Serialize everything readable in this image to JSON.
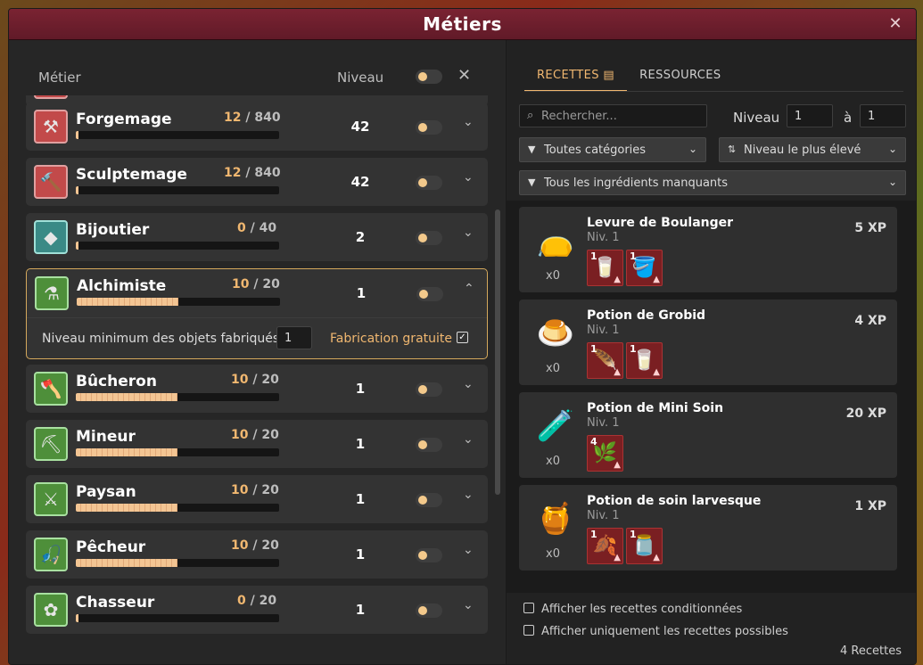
{
  "window": {
    "title": "Métiers"
  },
  "left": {
    "header": {
      "col_job": "Métier",
      "col_level": "Niveau"
    },
    "jobs": [
      {
        "name": "Forgemage",
        "xp_cur": "12",
        "xp_max": "840",
        "progress": 0.014,
        "level": "42",
        "icon": "hammer-icon"
      },
      {
        "name": "Sculptemage",
        "xp_cur": "12",
        "xp_max": "840",
        "progress": 0.014,
        "level": "42",
        "icon": "chisel-icon"
      },
      {
        "name": "Bijoutier",
        "xp_cur": "0",
        "xp_max": "40",
        "progress": 0.0,
        "level": "2",
        "icon": "gem-icon"
      },
      {
        "name": "Alchimiste",
        "xp_cur": "10",
        "xp_max": "20",
        "progress": 0.5,
        "level": "1",
        "icon": "potion-icon",
        "expanded": {
          "min_level_label": "Niveau minimum des objets fabriqués",
          "min_level_value": "1",
          "free_label": "Fabrication gratuite",
          "free_checked": true
        }
      },
      {
        "name": "Bûcheron",
        "xp_cur": "10",
        "xp_max": "20",
        "progress": 0.5,
        "level": "1",
        "icon": "axe-icon"
      },
      {
        "name": "Mineur",
        "xp_cur": "10",
        "xp_max": "20",
        "progress": 0.5,
        "level": "1",
        "icon": "pickaxe-icon"
      },
      {
        "name": "Paysan",
        "xp_cur": "10",
        "xp_max": "20",
        "progress": 0.5,
        "level": "1",
        "icon": "scythe-icon"
      },
      {
        "name": "Pêcheur",
        "xp_cur": "10",
        "xp_max": "20",
        "progress": 0.5,
        "level": "1",
        "icon": "fishing-rod-icon"
      },
      {
        "name": "Chasseur",
        "xp_cur": "0",
        "xp_max": "20",
        "progress": 0.0,
        "level": "1",
        "icon": "hunter-icon"
      }
    ]
  },
  "right": {
    "tabs": [
      {
        "label": "RECETTES",
        "active": true
      },
      {
        "label": "RESSOURCES",
        "active": false
      }
    ],
    "search_placeholder": "Rechercher...",
    "level_label": "Niveau",
    "level_from": "1",
    "level_to_label": "à",
    "level_to": "1",
    "filter_category": "Toutes catégories",
    "sort": "Niveau le plus élevé",
    "filter_ingredients": "Tous les ingrédients manquants",
    "recipes": [
      {
        "name": "Levure de Boulanger",
        "level": "Niv. 1",
        "xp": "5 XP",
        "qty": "x0",
        "icon": "yeast-bag-icon",
        "ingredients": [
          {
            "n": "1",
            "icon": "flour-icon"
          },
          {
            "n": "1",
            "icon": "bucket-icon"
          }
        ]
      },
      {
        "name": "Potion de Grobid",
        "level": "Niv. 1",
        "xp": "4 XP",
        "qty": "x0",
        "icon": "grobid-potion-icon",
        "ingredients": [
          {
            "n": "1",
            "icon": "feather-icon"
          },
          {
            "n": "1",
            "icon": "flour-icon"
          }
        ]
      },
      {
        "name": "Potion de Mini Soin",
        "level": "Niv. 1",
        "xp": "20 XP",
        "qty": "x0",
        "icon": "mini-heal-potion-icon",
        "ingredients": [
          {
            "n": "4",
            "icon": "herb-icon"
          }
        ]
      },
      {
        "name": "Potion de soin larvesque",
        "level": "Niv. 1",
        "xp": "1 XP",
        "qty": "x0",
        "icon": "larval-potion-icon",
        "ingredients": [
          {
            "n": "1",
            "icon": "leaf-icon"
          },
          {
            "n": "1",
            "icon": "vial-icon"
          }
        ]
      }
    ],
    "options": [
      {
        "label": "Afficher les recettes conditionnées",
        "checked": false
      },
      {
        "label": "Afficher uniquement les recettes possibles",
        "checked": false
      }
    ],
    "count": "4 Recettes"
  },
  "colors": {
    "accent": "#f0b770",
    "title_bar": "#7a2332",
    "missing_ingredient": "#7a1f22"
  }
}
